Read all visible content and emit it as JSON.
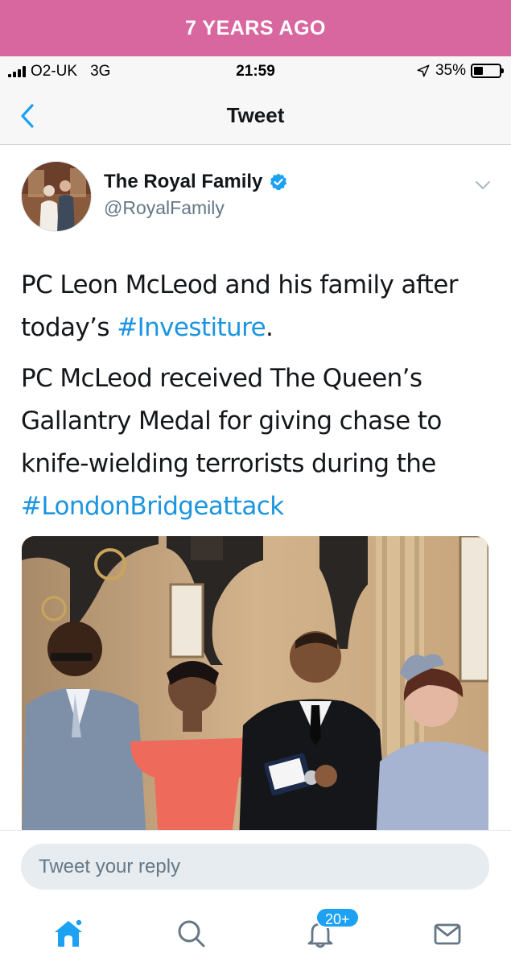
{
  "banner": {
    "text": "7 YEARS AGO",
    "color": "#d9679f"
  },
  "status_bar": {
    "carrier": "O2-UK",
    "network": "3G",
    "time": "21:59",
    "battery_text": "35%",
    "battery_level": 0.35,
    "location_icon": "location-arrow-icon"
  },
  "nav": {
    "title": "Tweet",
    "back_icon": "chevron-left-icon"
  },
  "tweet": {
    "author_name": "The Royal Family",
    "handle": "@RoyalFamily",
    "verified": true,
    "paragraph1_text": "PC Leon McLeod and his family after today’s ",
    "paragraph1_hashtag": "#Investiture",
    "paragraph1_end": ".",
    "paragraph2_text": "PC McLeod received The Queen’s Gallantry Medal for giving chase to knife-wielding terrorists during the ",
    "paragraph2_hashtag": "#LondonBridgeattack",
    "hashtag_color": "#1b95e0"
  },
  "reply": {
    "placeholder": "Tweet your reply"
  },
  "tab_bar": {
    "tabs": [
      "home-icon",
      "search-icon",
      "notifications-icon",
      "messages-icon"
    ],
    "notifications_badge": "20+",
    "accent": "#1da1f2"
  }
}
